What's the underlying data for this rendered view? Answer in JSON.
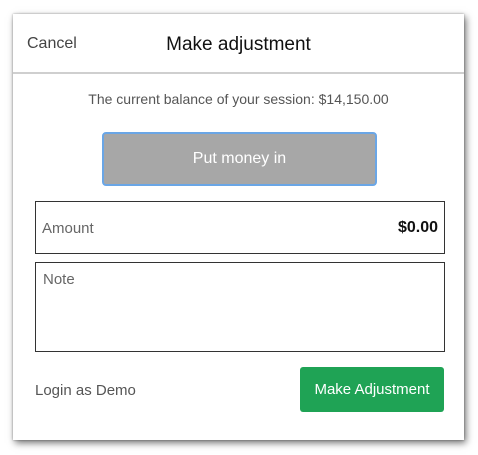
{
  "header": {
    "cancel_label": "Cancel",
    "title": "Make adjustment"
  },
  "balance_text": "The current balance of your session: $14,150.00",
  "put_money_label": "Put money in",
  "amount": {
    "label": "Amount",
    "value": "$0.00"
  },
  "note": {
    "placeholder": "Note"
  },
  "login_demo_label": "Login as Demo",
  "make_adjustment_label": "Make Adjustment",
  "colors": {
    "primary_button": "#1fa355",
    "toggle_button_bg": "#a7a7a7",
    "toggle_button_border": "#6aa6e6"
  }
}
